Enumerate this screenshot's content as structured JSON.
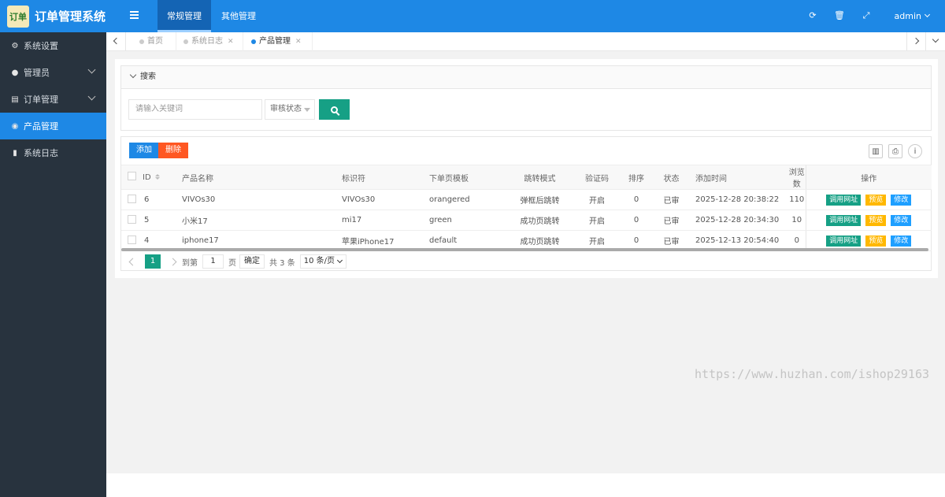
{
  "app": {
    "title": "订单管理系统",
    "logo_text": "订单"
  },
  "sidebar": {
    "items": [
      {
        "label": "系统设置",
        "icon": "gears-icon",
        "expandable": false
      },
      {
        "label": "管理员",
        "icon": "user-icon",
        "expandable": true
      },
      {
        "label": "订单管理",
        "icon": "list-icon",
        "expandable": true
      },
      {
        "label": "产品管理",
        "icon": "product-icon",
        "active": true
      },
      {
        "label": "系统日志",
        "icon": "file-icon",
        "expandable": false
      }
    ]
  },
  "header": {
    "tabs": [
      "常规管理",
      "其他管理"
    ],
    "active_tab": "常规管理",
    "user": "admin"
  },
  "page_tabs": [
    {
      "label": "首页",
      "closable": false
    },
    {
      "label": "系统日志",
      "closable": true
    },
    {
      "label": "产品管理",
      "closable": true,
      "active": true
    }
  ],
  "search": {
    "title": "搜索",
    "keyword_placeholder": "请输入关键词",
    "status_label": "审核状态"
  },
  "toolbar": {
    "add_label": "添加",
    "delete_label": "删除"
  },
  "table": {
    "columns": [
      "ID",
      "产品名称",
      "标识符",
      "下单页模板",
      "跳转模式",
      "验证码",
      "排序",
      "状态",
      "添加时间",
      "浏览数",
      "操作"
    ],
    "rows": [
      {
        "id": "6",
        "name": "VIVOs30",
        "key": "VIVOs30",
        "template": "orangered",
        "mode": "弹框后跳转",
        "captcha": "开启",
        "sort": "0",
        "status": "已审",
        "time": "2025-12-28 20:38:22",
        "views": "110"
      },
      {
        "id": "5",
        "name": "小米17",
        "key": "mi17",
        "template": "green",
        "mode": "成功页跳转",
        "captcha": "开启",
        "sort": "0",
        "status": "已审",
        "time": "2025-12-28 20:34:30",
        "views": "10"
      },
      {
        "id": "4",
        "name": "iphone17",
        "key": "苹果iPhone17",
        "template": "default",
        "mode": "成功页跳转",
        "captcha": "开启",
        "sort": "0",
        "status": "已审",
        "time": "2025-12-13 20:54:40",
        "views": "0"
      }
    ],
    "actions": {
      "url": "调用网址",
      "preview": "预览",
      "edit": "修改"
    }
  },
  "pager": {
    "current": "1",
    "goto_label": "到第",
    "goto_value": "1",
    "page_unit": "页",
    "confirm": "确定",
    "total": "共 3 条",
    "page_size": "10 条/页"
  },
  "watermark": "https://www.huzhan.com/ishop29163",
  "colors": {
    "primary": "#1e88e5",
    "sidebar": "#28333e",
    "teal": "#16a085",
    "danger": "#ff5722",
    "warn": "#ffb800"
  }
}
